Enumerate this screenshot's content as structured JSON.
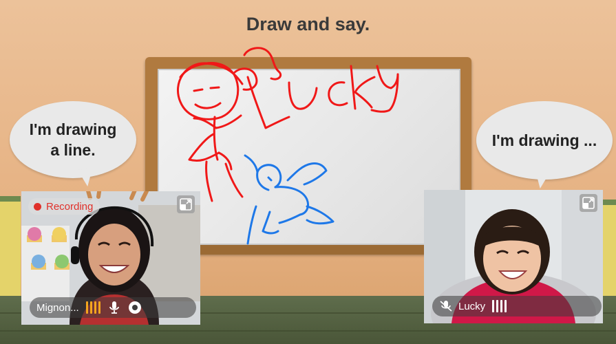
{
  "activity": {
    "title": "Draw and say."
  },
  "bubbles": {
    "left": {
      "line1": "I'm drawing",
      "line2": "a line."
    },
    "right": {
      "text": "I'm drawing ..."
    }
  },
  "drawing": {
    "word": "Lucky",
    "stroke_colors": {
      "girl": "#f01818",
      "bird": "#1e78e8"
    }
  },
  "participants": [
    {
      "role": "teacher",
      "name": "Mignon...",
      "recording_label": "Recording",
      "audio_level_color": "#f4a51e"
    },
    {
      "role": "student",
      "name": "Lucky",
      "audio_level_color": "#ffffff"
    }
  ],
  "colors": {
    "recording": "#e0302a"
  }
}
